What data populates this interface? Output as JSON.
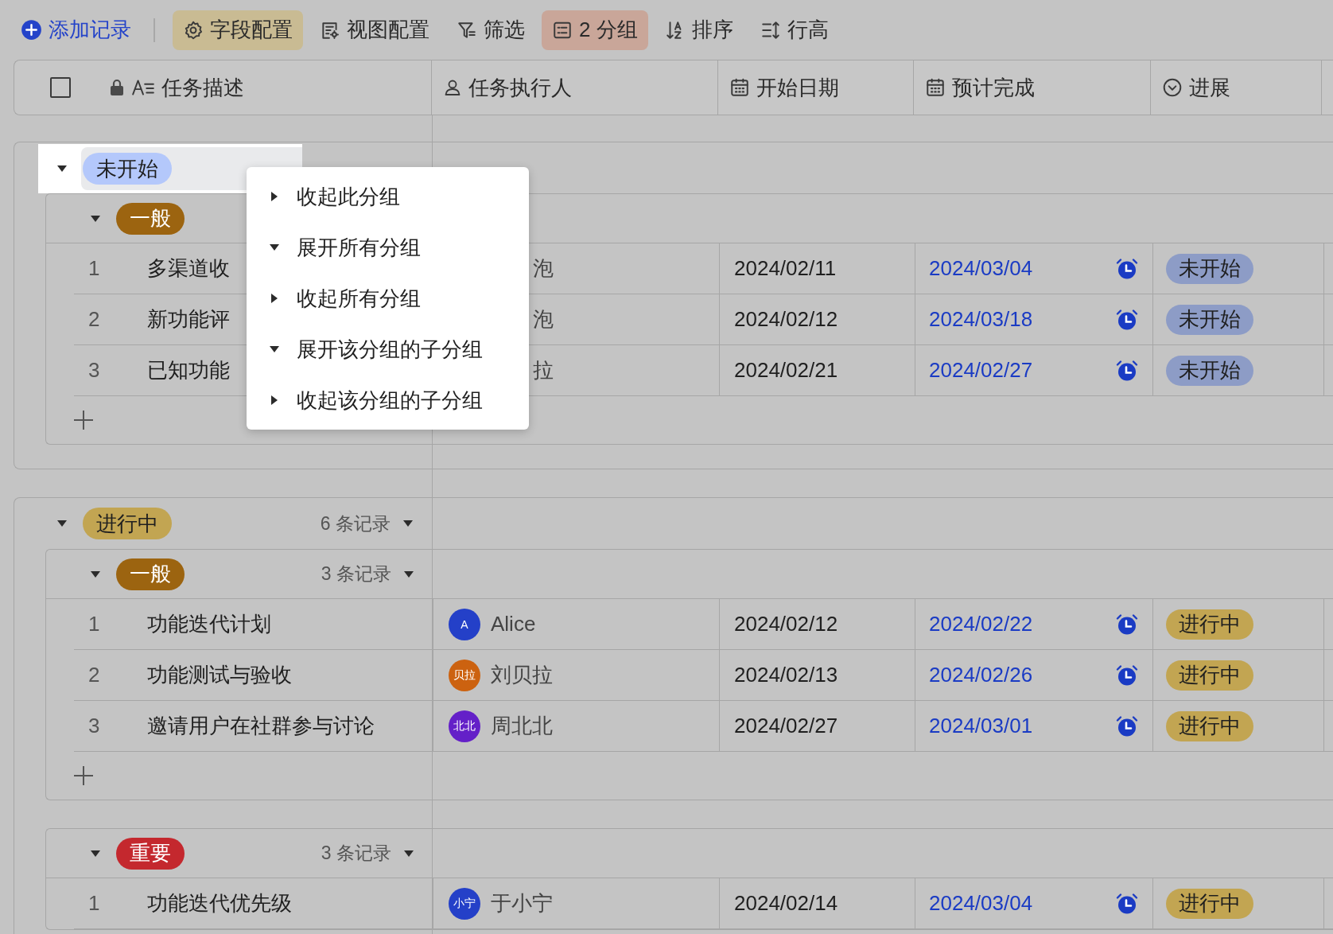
{
  "toolbar": [
    {
      "kind": "add",
      "label": "添加记录",
      "selected": false
    },
    {
      "kind": "fields",
      "label": "字段配置",
      "selected": true,
      "color": "#c9bb93"
    },
    {
      "kind": "view",
      "label": "视图配置",
      "selected": false
    },
    {
      "kind": "filter",
      "label": "筛选",
      "selected": false
    },
    {
      "kind": "group",
      "label": "2 分组",
      "selected": true,
      "color": "#c9a699"
    },
    {
      "kind": "sort",
      "label": "排序",
      "selected": false
    },
    {
      "kind": "rowheight",
      "label": "行高",
      "selected": false
    }
  ],
  "select_all_checked": false,
  "columns": [
    {
      "kind": "text",
      "label": "任务描述",
      "locked": true
    },
    {
      "kind": "person",
      "label": "任务执行人",
      "locked": false
    },
    {
      "kind": "date",
      "label": "开始日期",
      "locked": false
    },
    {
      "kind": "date",
      "label": "预计完成",
      "locked": false
    },
    {
      "kind": "status",
      "label": "进展",
      "locked": false
    }
  ],
  "groups": [
    {
      "label": "未开始",
      "color": "#b4c8fb",
      "expanded": true,
      "highlighted": true,
      "subgroups": [
        {
          "label": "一般",
          "color": "#9c6410",
          "expanded": true,
          "add_row": true,
          "rows": [
            {
              "index": "1",
              "title": "多渠道收",
              "assignee": {
                "name": "泡"
              },
              "start": "2024/02/11",
              "due": "2024/03/04",
              "reminder": true,
              "status": {
                "label": "未开始",
                "color": "#8d9cc6"
              }
            },
            {
              "index": "2",
              "title": "新功能评",
              "assignee": {
                "name": "泡"
              },
              "start": "2024/02/12",
              "due": "2024/03/18",
              "reminder": true,
              "status": {
                "label": "未开始",
                "color": "#8d9cc6"
              }
            },
            {
              "index": "3",
              "title": "已知功能",
              "assignee": {
                "name": "拉"
              },
              "start": "2024/02/21",
              "due": "2024/02/27",
              "reminder": true,
              "status": {
                "label": "未开始",
                "color": "#8d9cc6"
              }
            }
          ]
        }
      ]
    },
    {
      "label": "进行中",
      "color": "#c2a552",
      "expanded": true,
      "highlighted": false,
      "count": "6 条记录",
      "subgroups": [
        {
          "label": "一般",
          "color": "#9c6410",
          "expanded": true,
          "add_row": true,
          "count": "3 条记录",
          "rows": [
            {
              "index": "1",
              "title": "功能迭代计划",
              "assignee": {
                "initials": "A",
                "name": "Alice",
                "color": "#2440c8"
              },
              "start": "2024/02/12",
              "due": "2024/02/22",
              "reminder": true,
              "status": {
                "label": "进行中",
                "color": "#c2a552"
              }
            },
            {
              "index": "2",
              "title": "功能测试与验收",
              "assignee": {
                "initials": "贝拉",
                "name": "刘贝拉",
                "color": "#cc6210"
              },
              "start": "2024/02/13",
              "due": "2024/02/26",
              "reminder": true,
              "status": {
                "label": "进行中",
                "color": "#c2a552"
              }
            },
            {
              "index": "3",
              "title": "邀请用户在社群参与讨论",
              "assignee": {
                "initials": "北北",
                "name": "周北北",
                "color": "#6420c8"
              },
              "start": "2024/02/27",
              "due": "2024/03/01",
              "reminder": true,
              "status": {
                "label": "进行中",
                "color": "#c2a552"
              }
            }
          ]
        },
        {
          "label": "重要",
          "color": "#c4282e",
          "expanded": true,
          "count": "3 条记录",
          "rows": [
            {
              "index": "1",
              "title": "功能迭代优先级",
              "assignee": {
                "initials": "小宁",
                "name": "于小宁",
                "color": "#2440c8"
              },
              "start": "2024/02/14",
              "due": "2024/03/04",
              "reminder": true,
              "status": {
                "label": "进行中",
                "color": "#c2a552"
              }
            }
          ]
        }
      ]
    }
  ],
  "menu": [
    {
      "kind": "collapse",
      "label": "收起此分组"
    },
    {
      "kind": "expand",
      "label": "展开所有分组"
    },
    {
      "kind": "collapse",
      "label": "收起所有分组"
    },
    {
      "kind": "expand",
      "label": "展开该分组的子分组"
    },
    {
      "kind": "collapse",
      "label": "收起该分组的子分组"
    }
  ]
}
